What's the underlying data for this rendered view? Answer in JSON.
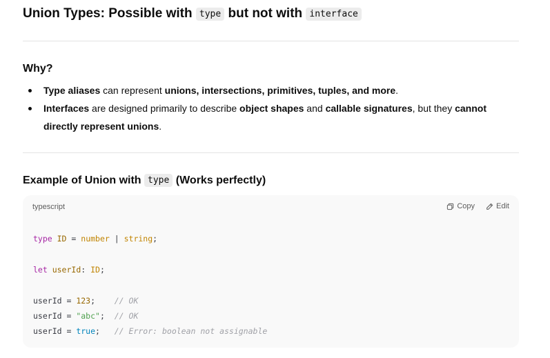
{
  "heading": {
    "prefix": "Union Types: Possible with ",
    "code1": "type",
    "middle": " but not with ",
    "code2": "interface"
  },
  "why": {
    "title": "Why?",
    "bullet1": {
      "b1": "Type aliases",
      "t1": " can represent ",
      "b2": "unions, intersections, primitives, tuples, and more",
      "t2": "."
    },
    "bullet2": {
      "b1": "Interfaces",
      "t1": " are designed primarily to describe ",
      "b2": "object shapes",
      "t2": " and ",
      "b3": "callable signatures",
      "t3": ", but they ",
      "b4": "cannot directly represent unions",
      "t4": "."
    }
  },
  "example": {
    "prefix": "Example of Union with ",
    "code": "type",
    "suffix": " (Works perfectly)"
  },
  "codeblock": {
    "language": "typescript",
    "copy_label": "Copy",
    "edit_label": "Edit",
    "lines": {
      "l1": {
        "kw": "type",
        "name": " ID",
        "eq": " = ",
        "t1": "number",
        "bar": " | ",
        "t2": "string",
        "semi": ";"
      },
      "l2": {
        "kw": "let",
        "name": " userId",
        "colon": ": ",
        "type": "ID",
        "semi": ";"
      },
      "l3": {
        "name": "userId",
        "eq": " = ",
        "val": "123",
        "semi": ";",
        "pad": "    ",
        "comment": "// OK"
      },
      "l4": {
        "name": "userId",
        "eq": " = ",
        "val": "\"abc\"",
        "semi": ";",
        "pad": "  ",
        "comment": "// OK"
      },
      "l5": {
        "name": "userId",
        "eq": " = ",
        "val": "true",
        "semi": ";",
        "pad": "   ",
        "comment": "// Error: boolean not assignable"
      }
    }
  }
}
